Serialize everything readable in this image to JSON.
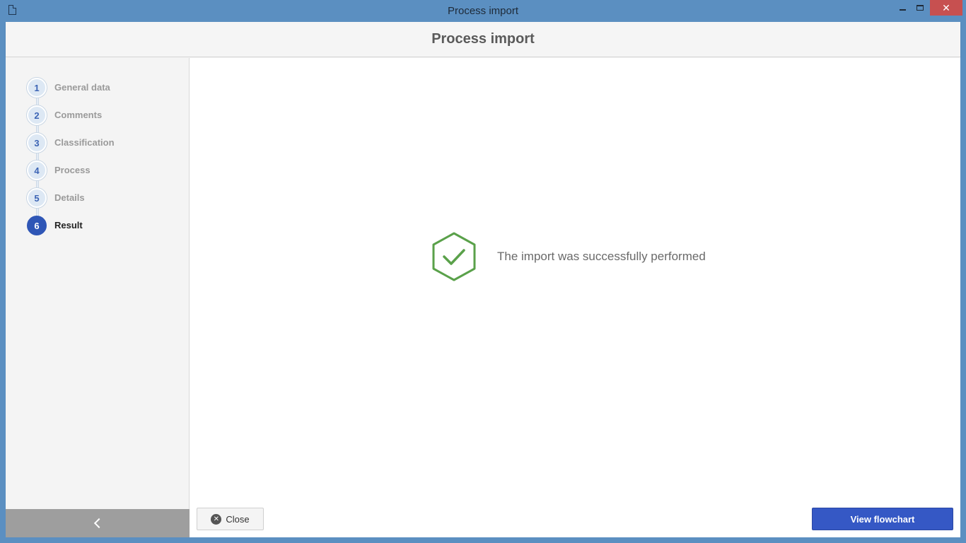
{
  "window": {
    "title": "Process import"
  },
  "header": {
    "title": "Process import"
  },
  "steps": [
    {
      "number": "1",
      "label": "General data",
      "active": false
    },
    {
      "number": "2",
      "label": "Comments",
      "active": false
    },
    {
      "number": "3",
      "label": "Classification",
      "active": false
    },
    {
      "number": "4",
      "label": "Process",
      "active": false
    },
    {
      "number": "5",
      "label": "Details",
      "active": false
    },
    {
      "number": "6",
      "label": "Result",
      "active": true
    }
  ],
  "result": {
    "message": "The import was successfully performed",
    "icon": "hexagon-check-icon",
    "color": "#5aa14a"
  },
  "footer": {
    "close_label": "Close",
    "flowchart_label": "View flowchart"
  },
  "colors": {
    "accent": "#3558c5",
    "success": "#5aa14a",
    "titlebar": "#5b8fc1",
    "close_window": "#c75050"
  }
}
